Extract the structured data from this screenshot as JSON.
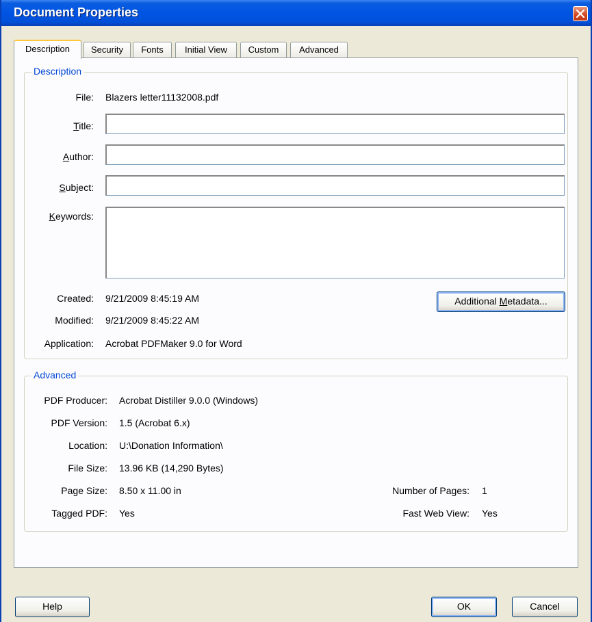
{
  "window": {
    "title": "Document Properties"
  },
  "tabs": [
    {
      "label": "Description",
      "active": true
    },
    {
      "label": "Security"
    },
    {
      "label": "Fonts"
    },
    {
      "label": "Initial View"
    },
    {
      "label": "Custom"
    },
    {
      "label": "Advanced"
    }
  ],
  "description": {
    "legend": "Description",
    "file_label": "File:",
    "file_value": "Blazers letter11132008.pdf",
    "title_label": "Title:",
    "title_value": "",
    "author_label": "Author:",
    "author_value": "",
    "subject_label": "Subject:",
    "subject_value": "",
    "keywords_label": "Keywords:",
    "keywords_value": "",
    "created_label": "Created:",
    "created_value": "9/21/2009 8:45:19 AM",
    "modified_label": "Modified:",
    "modified_value": "9/21/2009 8:45:22 AM",
    "application_label": "Application:",
    "application_value": "Acrobat PDFMaker 9.0 for Word",
    "metadata_button": "Additional Metadata..."
  },
  "advanced": {
    "legend": "Advanced",
    "producer_label": "PDF Producer:",
    "producer_value": "Acrobat Distiller 9.0.0 (Windows)",
    "version_label": "PDF Version:",
    "version_value": "1.5 (Acrobat 6.x)",
    "location_label": "Location:",
    "location_value": "U:\\Donation Information\\",
    "filesize_label": "File Size:",
    "filesize_value": "13.96 KB (14,290 Bytes)",
    "pagesize_label": "Page Size:",
    "pagesize_value": "8.50 x 11.00 in",
    "pages_label": "Number of Pages:",
    "pages_value": "1",
    "tagged_label": "Tagged PDF:",
    "tagged_value": "Yes",
    "fastweb_label": "Fast Web View:",
    "fastweb_value": "Yes"
  },
  "footer": {
    "help_button": "Help",
    "ok_button": "OK",
    "cancel_button": "Cancel"
  },
  "icons": {
    "close": "close-icon"
  },
  "colors": {
    "titlebar": "#0054e3",
    "group_legend": "#0046d5",
    "active_tab_accent": "#ffc83c"
  }
}
